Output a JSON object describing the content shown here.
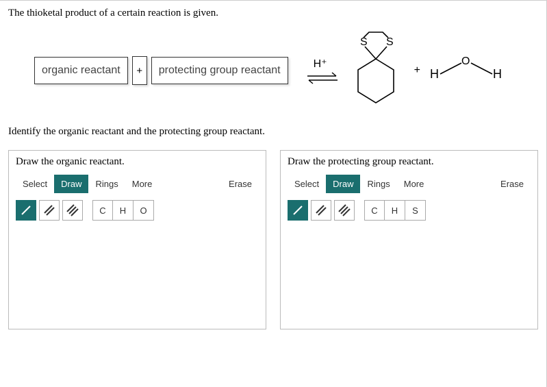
{
  "prompt_line": "The thioketal product of a certain reaction is given.",
  "reaction": {
    "reactant1_label": "organic reactant",
    "plus": "+",
    "reactant2_label": "protecting group reactant",
    "catalyst": "H⁺",
    "plus2": "+",
    "byproduct_left": "H",
    "byproduct_right": "H"
  },
  "sub_prompt": "Identify the organic reactant and the protecting group reactant.",
  "panel1": {
    "title": "Draw the organic reactant.",
    "tabs": {
      "select": "Select",
      "draw": "Draw",
      "rings": "Rings",
      "more": "More"
    },
    "erase": "Erase",
    "elements": [
      "C",
      "H",
      "O"
    ]
  },
  "panel2": {
    "title": "Draw the protecting group reactant.",
    "tabs": {
      "select": "Select",
      "draw": "Draw",
      "rings": "Rings",
      "more": "More"
    },
    "erase": "Erase",
    "elements": [
      "C",
      "H",
      "S"
    ]
  },
  "chem": {
    "product_s1": "S",
    "product_s2": "S",
    "water_o": "O"
  }
}
